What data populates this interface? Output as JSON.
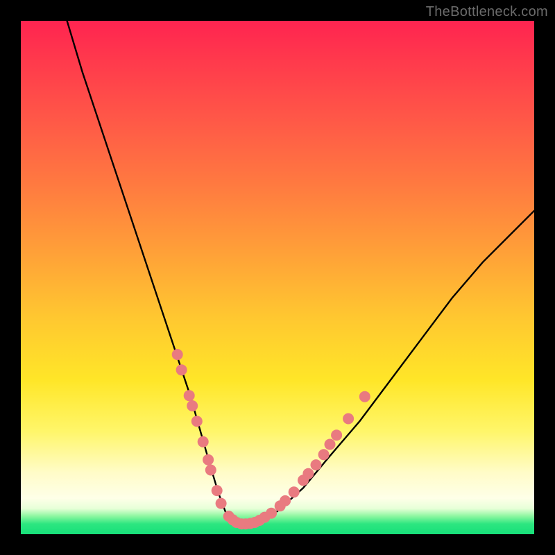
{
  "watermark": "TheBottleneck.com",
  "chart_data": {
    "type": "line",
    "title": "",
    "xlabel": "",
    "ylabel": "",
    "xlim": [
      0,
      100
    ],
    "ylim": [
      0,
      100
    ],
    "series": [
      {
        "name": "bottleneck-curve",
        "x": [
          9,
          12,
          15,
          18,
          21,
          24,
          27,
          30,
          33,
          35,
          37,
          38.5,
          40,
          41.5,
          43,
          46,
          50,
          55,
          60,
          66,
          72,
          78,
          84,
          90,
          96,
          100
        ],
        "y": [
          100,
          90,
          81,
          72,
          63,
          54,
          45,
          36,
          27,
          20,
          13,
          8,
          4,
          2.2,
          2,
          2.4,
          4.5,
          9,
          15,
          22,
          30,
          38,
          46,
          53,
          59,
          63
        ]
      }
    ],
    "markers": {
      "name": "highlight-dots",
      "color": "#e97a80",
      "points": [
        {
          "x": 30.5,
          "y": 35
        },
        {
          "x": 31.3,
          "y": 32
        },
        {
          "x": 32.8,
          "y": 27
        },
        {
          "x": 33.4,
          "y": 25
        },
        {
          "x": 34.3,
          "y": 22
        },
        {
          "x": 35.5,
          "y": 18
        },
        {
          "x": 36.5,
          "y": 14.5
        },
        {
          "x": 37.0,
          "y": 12.5
        },
        {
          "x": 38.2,
          "y": 8.5
        },
        {
          "x": 39.0,
          "y": 6
        },
        {
          "x": 40.5,
          "y": 3.5
        },
        {
          "x": 41.3,
          "y": 2.8
        },
        {
          "x": 42.0,
          "y": 2.3
        },
        {
          "x": 43.0,
          "y": 2.0
        },
        {
          "x": 43.8,
          "y": 2.0
        },
        {
          "x": 44.7,
          "y": 2.1
        },
        {
          "x": 45.6,
          "y": 2.3
        },
        {
          "x": 46.5,
          "y": 2.7
        },
        {
          "x": 47.5,
          "y": 3.3
        },
        {
          "x": 48.8,
          "y": 4.1
        },
        {
          "x": 50.5,
          "y": 5.5
        },
        {
          "x": 51.5,
          "y": 6.5
        },
        {
          "x": 53.2,
          "y": 8.2
        },
        {
          "x": 55.0,
          "y": 10.5
        },
        {
          "x": 56.0,
          "y": 11.8
        },
        {
          "x": 57.5,
          "y": 13.5
        },
        {
          "x": 59.0,
          "y": 15.5
        },
        {
          "x": 60.2,
          "y": 17.5
        },
        {
          "x": 61.5,
          "y": 19.3
        },
        {
          "x": 63.8,
          "y": 22.5
        },
        {
          "x": 67.0,
          "y": 26.8
        }
      ]
    }
  }
}
